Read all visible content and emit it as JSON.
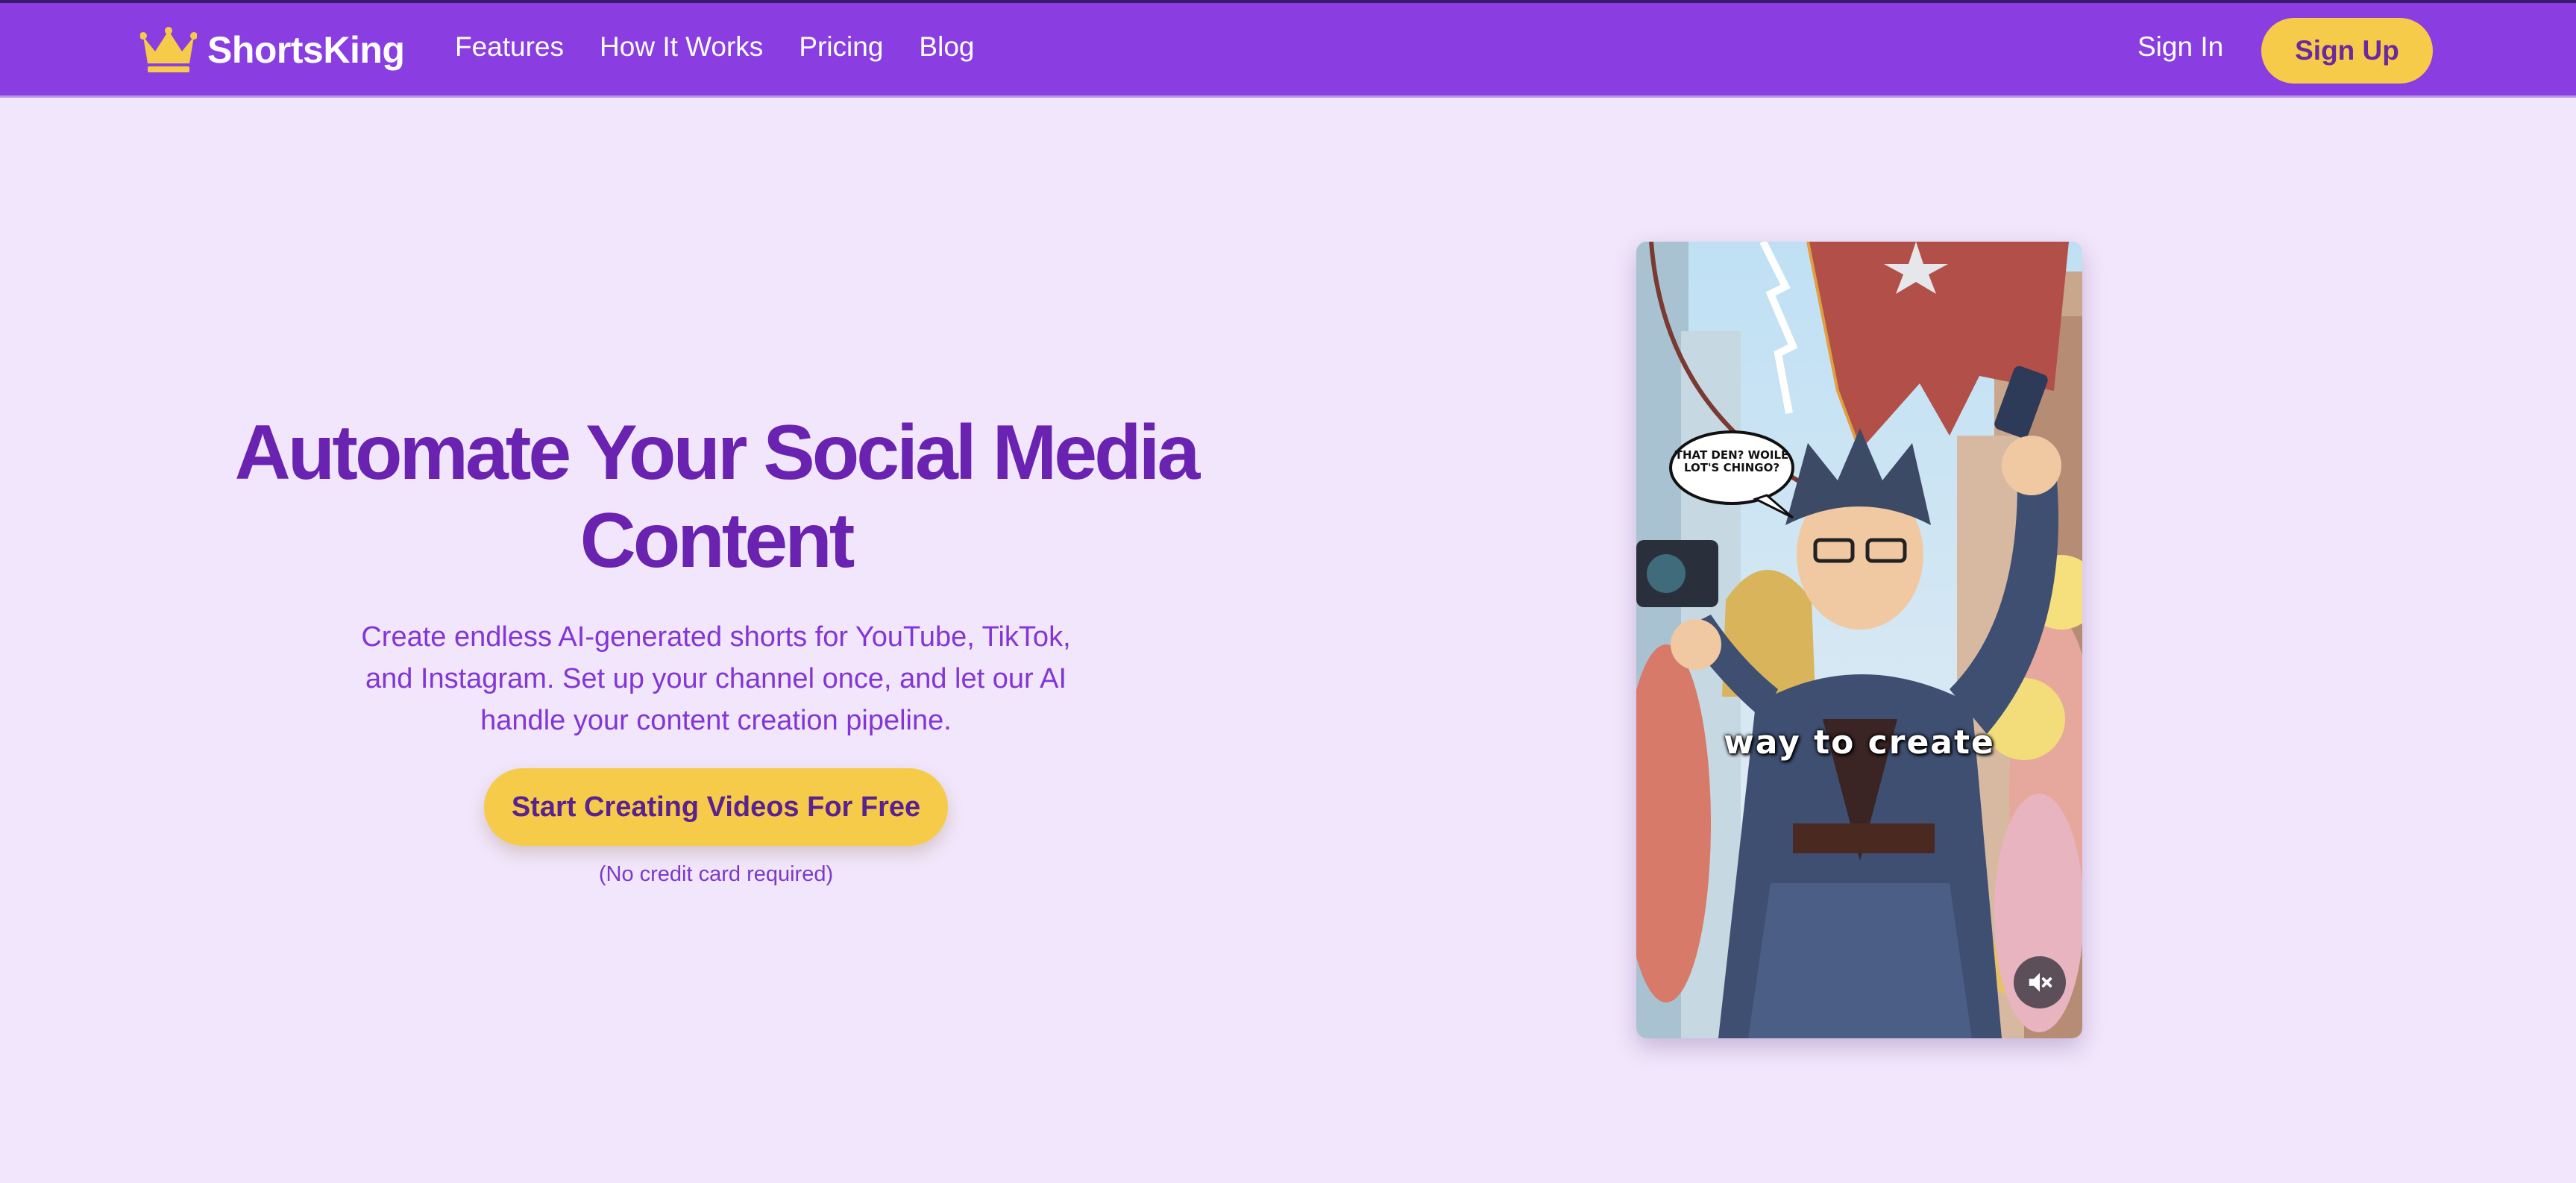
{
  "brand": {
    "name": "ShortsKing",
    "logo_icon": "crown-icon",
    "accent": "#8a3ee2",
    "yellow": "#f6cb49"
  },
  "nav": {
    "links": [
      "Features",
      "How It Works",
      "Pricing",
      "Blog"
    ],
    "sign_in": "Sign In",
    "sign_up": "Sign Up"
  },
  "hero": {
    "title": "Automate Your Social Media Content",
    "description": "Create endless AI-generated shorts for YouTube, TikTok, and Instagram. Set up your channel once, and let our AI handle your content creation pipeline.",
    "cta": "Start Creating Videos For Free",
    "note": "(No credit card required)"
  },
  "video": {
    "caption": "way to create",
    "speech_bubble": "THAT DEN? WOILE LOT'S CHINGO?",
    "mute_icon": "volume-mute-icon"
  }
}
